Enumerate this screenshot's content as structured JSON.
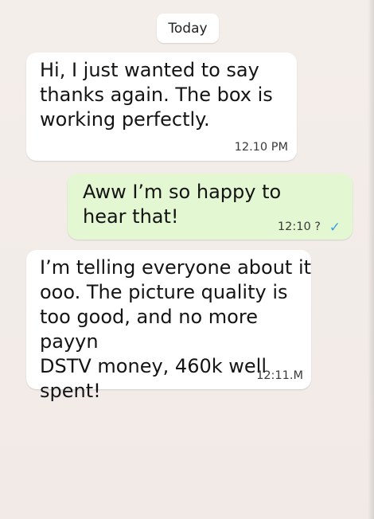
{
  "date_chip": "Today",
  "messages": [
    {
      "direction": "incoming",
      "text": "Hi, I just wanted to say\nthanks again. The box is\nworking perfectly.",
      "time": "12.10 PM"
    },
    {
      "direction": "outgoing",
      "text": "Aww I’m so happy to\nhear that!",
      "time": "12:10 ?",
      "status_icon": "check-icon"
    },
    {
      "direction": "incoming",
      "text": "I’m telling everyone about it\nooo. The picture quality is\ntoo good, and no more payyn\nDSTV money, 460k well spent!",
      "time": "12:11.M"
    }
  ],
  "colors": {
    "background": "#f3ece8",
    "incoming_bubble": "#ffffff",
    "outgoing_bubble": "#e3f7d2",
    "tick": "#3aa0e6"
  }
}
